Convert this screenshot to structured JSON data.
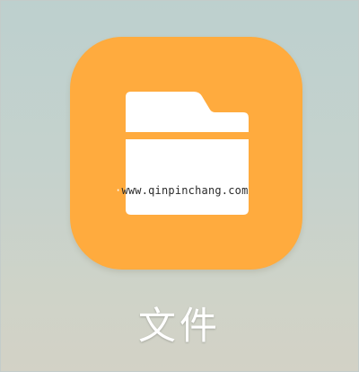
{
  "app": {
    "label": "文件",
    "icon_name": "folder-icon",
    "icon_background": "#ffab3e",
    "icon_glyph_color": "#ffffff"
  },
  "watermark": {
    "text": "www.qinpinchang.com"
  },
  "colors": {
    "background_top": "#bdd0ce",
    "background_bottom": "#d3d2c6"
  }
}
